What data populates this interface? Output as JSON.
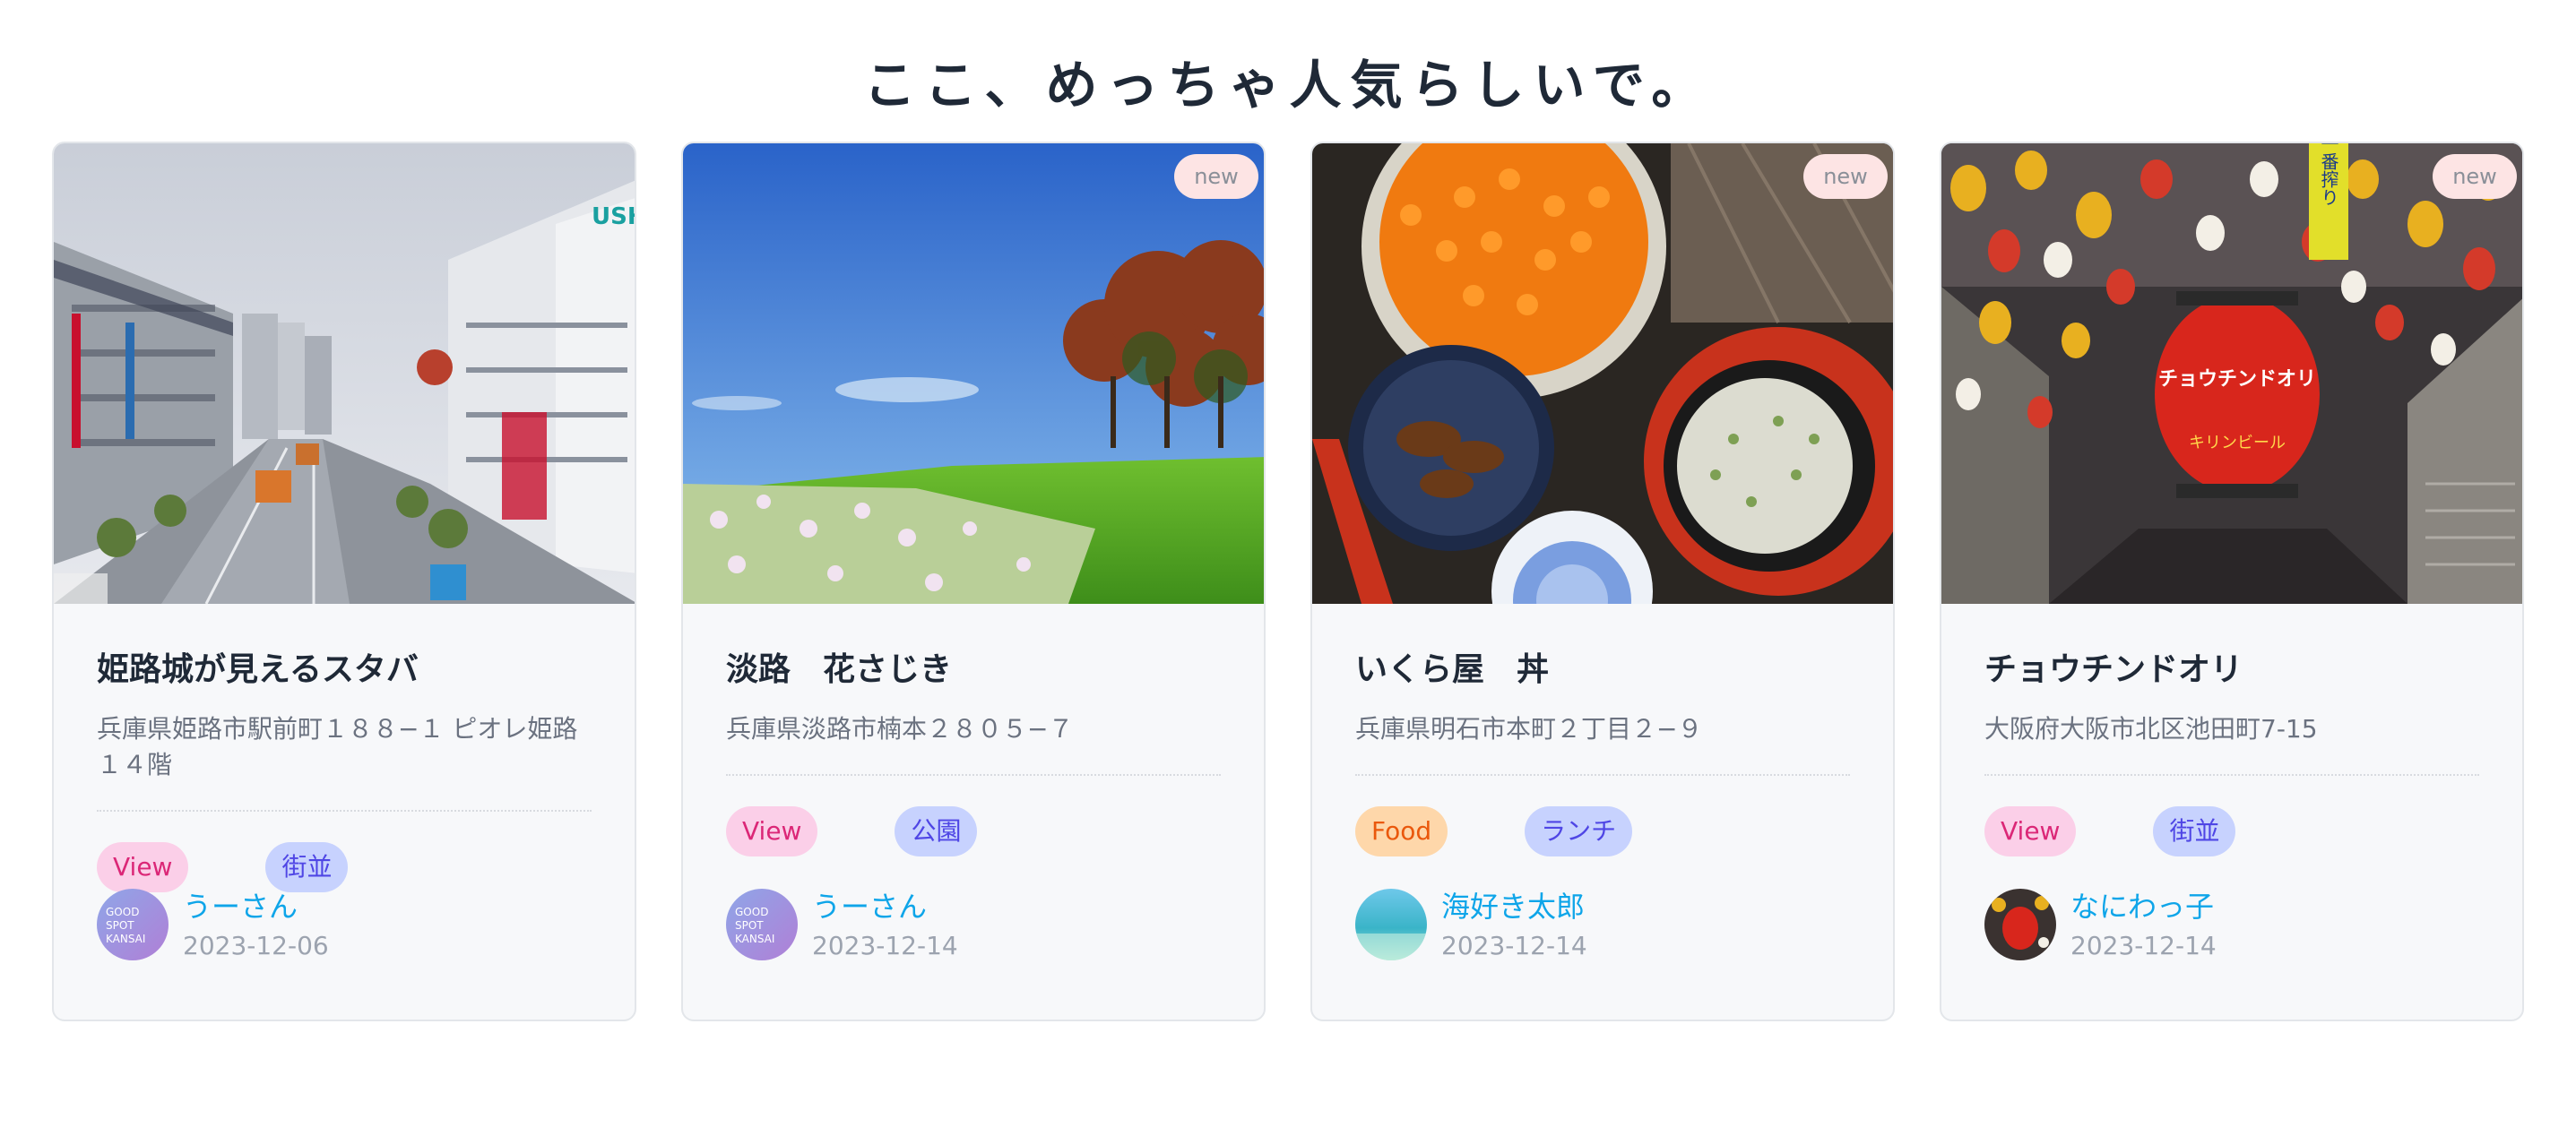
{
  "header": {
    "title": "ここ、めっちゃ人気らしいで。"
  },
  "cards": [
    {
      "photo": "himeji-street-photo",
      "new_badge": "",
      "name": "姫路城が見えるスタバ",
      "address": "兵庫県姫路市駅前町１８８−１ ピオレ姫路 １４階",
      "tags": [
        {
          "label": "View",
          "style": "view"
        },
        {
          "label": "街並",
          "style": "cat"
        }
      ],
      "author": {
        "name": "うーさん",
        "avatar": "good-spot-kansai-logo",
        "date": "2023-12-06"
      }
    },
    {
      "photo": "awaji-flower-field-photo",
      "new_badge": "new",
      "name": "淡路　花さじき",
      "address": "兵庫県淡路市楠本２８０５−７",
      "tags": [
        {
          "label": "View",
          "style": "view"
        },
        {
          "label": "公園",
          "style": "cat"
        }
      ],
      "author": {
        "name": "うーさん",
        "avatar": "good-spot-kansai-logo",
        "date": "2023-12-14"
      }
    },
    {
      "photo": "ikura-don-photo",
      "new_badge": "new",
      "name": "いくら屋　丼",
      "address": "兵庫県明石市本町２丁目２−９",
      "tags": [
        {
          "label": "Food",
          "style": "food"
        },
        {
          "label": "ランチ",
          "style": "cat"
        }
      ],
      "author": {
        "name": "海好き太郎",
        "avatar": "sea-avatar",
        "date": "2023-12-14"
      }
    },
    {
      "photo": "lantern-street-photo",
      "new_badge": "new",
      "name": "チョウチンドオリ",
      "address": "大阪府大阪市北区池田町7-15",
      "tags": [
        {
          "label": "View",
          "style": "view"
        },
        {
          "label": "街並",
          "style": "cat"
        }
      ],
      "author": {
        "name": "なにわっ子",
        "avatar": "lantern-avatar",
        "date": "2023-12-14"
      }
    }
  ],
  "logo_text": {
    "line1": "GOOD",
    "line2": "SPOT",
    "line3": "KANSAI"
  },
  "photo_text": {
    "store_sign": "USH",
    "lantern_big": "チョウチンドオリ",
    "lantern_sub": "キリンビール",
    "banner": "一番搾り"
  },
  "colors": {
    "view_tag_bg": "#fbcfe8",
    "view_tag_text": "#db2777",
    "food_tag_bg": "#fed7aa",
    "food_tag_text": "#ea580c",
    "category_tag_bg": "#c7d2fe",
    "category_tag_text": "#4f46e5",
    "author_name": "#0ea5e9",
    "new_badge_bg": "#fde4e4"
  }
}
